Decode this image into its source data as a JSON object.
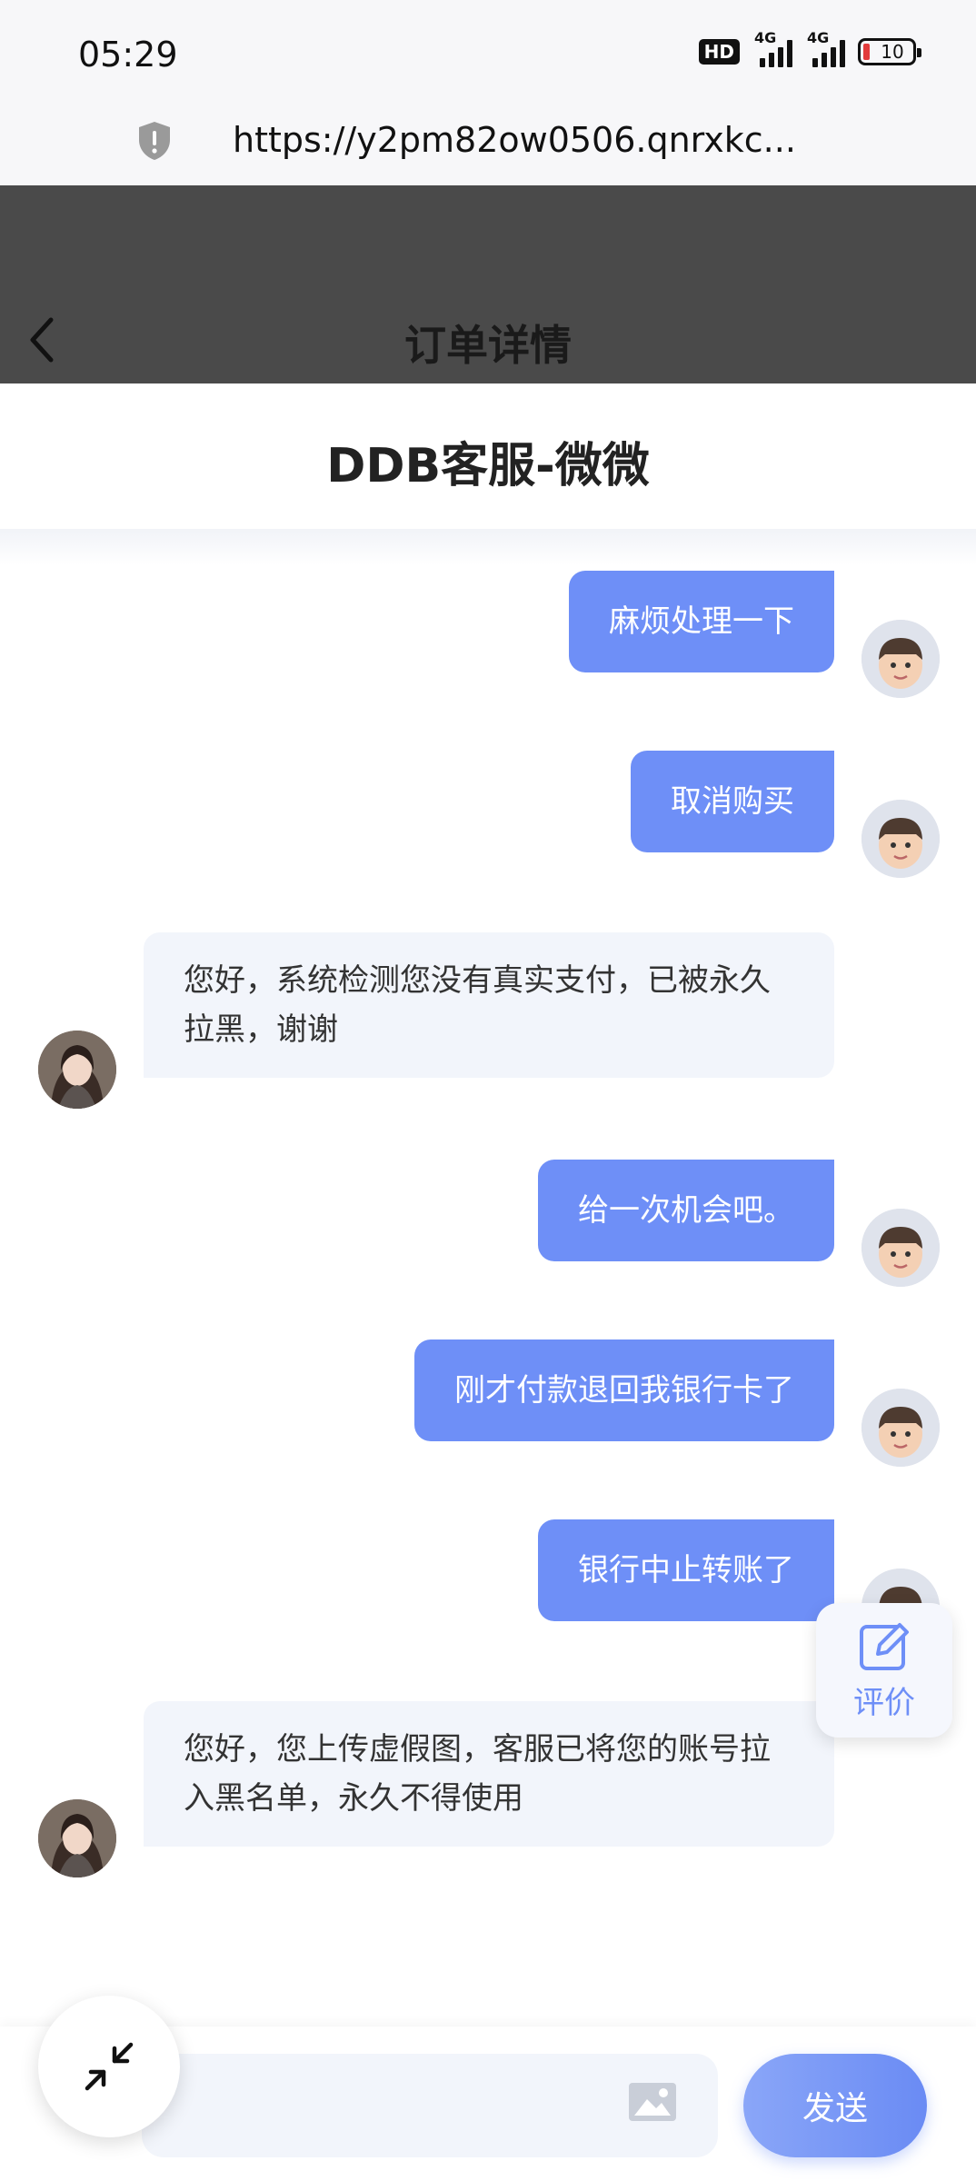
{
  "status_bar": {
    "time": "05:29",
    "hd": "HD",
    "net1": "4G",
    "net2": "4G",
    "battery": "10"
  },
  "browser": {
    "url": "https://y2pm82ow0506.qnrxkc..."
  },
  "page_header": {
    "title": "订单详情"
  },
  "chat": {
    "title": "DDB客服-微微",
    "messages": [
      {
        "from": "user",
        "text": "麻烦处理一下"
      },
      {
        "from": "user",
        "text": "取消购买"
      },
      {
        "from": "agent",
        "text": "您好，系统检测您没有真实支付，已被永久拉黑，谢谢"
      },
      {
        "from": "user",
        "text": "给一次机会吧。"
      },
      {
        "from": "user",
        "text": "刚才付款退回我银行卡了"
      },
      {
        "from": "user",
        "text": "银行中止转账了"
      },
      {
        "from": "agent",
        "text": "您好，您上传虚假图，客服已将您的账号拉入黑名单，永久不得使用"
      }
    ],
    "rate_label": "评价",
    "input": {
      "value": "",
      "placeholder": ""
    },
    "send_label": "发送"
  },
  "colors": {
    "accent": "#6e8ff7",
    "agent_bubble": "#f2f5fb",
    "header_dim": "#4a4a4a"
  },
  "icons": [
    "shield-icon",
    "back-chevron-icon",
    "user-avatar",
    "agent-avatar",
    "edit-icon",
    "image-icon",
    "collapse-icon"
  ]
}
